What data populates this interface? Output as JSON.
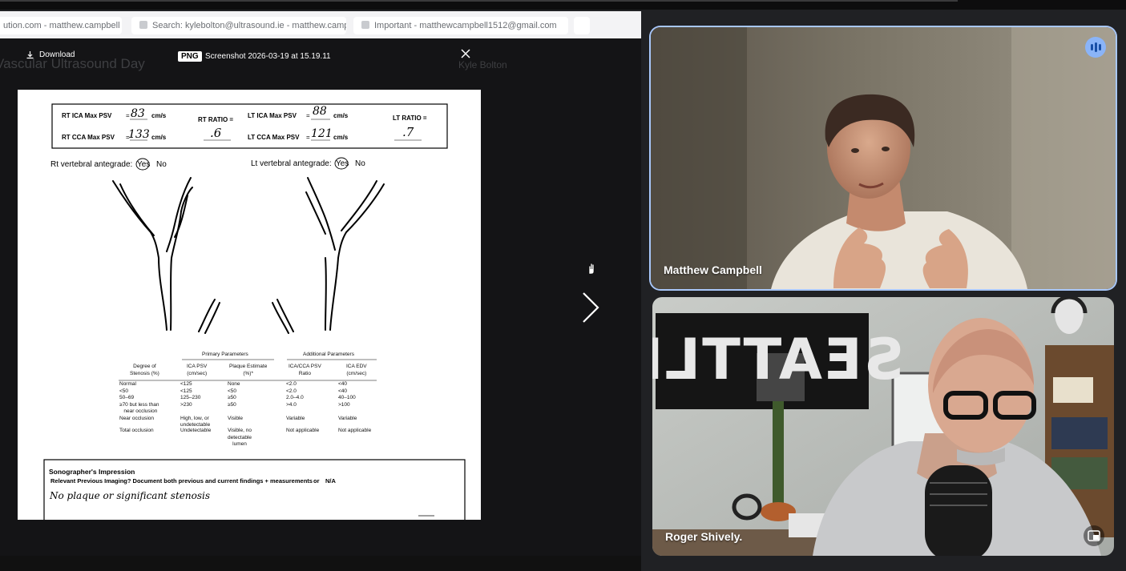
{
  "browser": {
    "tabs": [
      {
        "label": "ution.com - matthew.campbell"
      },
      {
        "label": "Search: kylebolton@ultrasound.ie - matthew.camp"
      },
      {
        "label": "Important - matthewcampbell1512@gmail.com"
      }
    ],
    "background_heading": "Vascular Ultrasound Day",
    "background_name": "Kyle Bolton"
  },
  "viewer": {
    "download_label": "Download",
    "file_type": "PNG",
    "file_name": "Screenshot 2026-03-19 at 15.19.11"
  },
  "doc": {
    "rt_ica_label": "RT ICA Max PSV",
    "rt_ica_value": "83",
    "rt_cca_label": "RT CCA Max PSV",
    "rt_cca_value": "133",
    "rt_ratio_label": "RT RATIO =",
    "rt_ratio_value": ".6",
    "lt_ica_label": "LT ICA Max PSV",
    "lt_ica_value": "88",
    "lt_cca_label": "LT CCA Max PSV",
    "lt_cca_value": "121",
    "lt_ratio_label": "LT RATIO =",
    "lt_ratio_value": ".7",
    "unit": "cm/s",
    "eq": "=",
    "rt_vertebral": "Rt vertebral antegrade:",
    "lt_vertebral": "Lt vertebral antegrade:",
    "yes": "Yes",
    "no": "No",
    "criteria": {
      "primary_header": "Primary Parameters",
      "additional_header": "Additional Parameters",
      "col_degree": "Degree of\nStenosis (%)",
      "col_ica_psv": "ICA PSV\n(cm/sec)",
      "col_plaque": "Plaque Estimate\n(%)*",
      "col_ratio": "ICA/CCA PSV\nRatio",
      "col_edv": "ICA EDV\n(cm/sec)",
      "degree": "Normal\n<50\n50–69\n≥70 but less than\n   near occlusion\nNear occlusion",
      "ica_psv": "<125\n<125\n125–230\n>230\n\nHigh, low, or\nundetectable",
      "plaque": "None\n<50\n≥50\n≥50\n\nVisible",
      "ratio": "<2.0\n<2.0\n2.0–4.0\n>4.0\n\nVariable",
      "edv": "<40\n<40\n40–100\n>100\n\nVariable",
      "total_label": "Total occlusion",
      "total_psv": "Undetectable",
      "total_plaque": "Visible, no\ndetectable\nlumen",
      "total_ratio": "Not applicable",
      "total_edv": "Not applicable"
    },
    "impression_title": "Sonographer's Impression",
    "impression_sub": "Relevant Previous Imaging? Document both previous and current findings + measurements",
    "impression_or": "or",
    "impression_na": "N/A",
    "impression_text": "No plaque or significant stenosis"
  },
  "participants": [
    {
      "name": "Matthew Campbell"
    },
    {
      "name": "Roger Shively."
    }
  ],
  "wall_sign": "SEATTLE",
  "colors": {
    "active_border": "#a8c7fa",
    "speaking": "#8ab4f8"
  }
}
